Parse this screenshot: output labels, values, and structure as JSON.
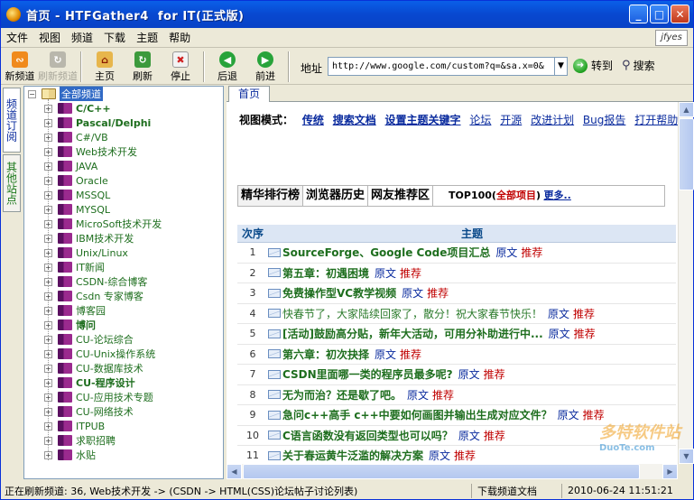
{
  "window": {
    "title": "首页 - HTFGather4  for IT(正式版)"
  },
  "menu": [
    "文件",
    "视图",
    "频道",
    "下载",
    "主题",
    "帮助"
  ],
  "logo_text": "jfyes",
  "toolbar": {
    "buttons": [
      {
        "label": "新频道",
        "icon": "rss-icon",
        "disabled": false
      },
      {
        "label": "刷新频道",
        "icon": "refresh-channel-icon",
        "disabled": true
      },
      {
        "label": "主页",
        "icon": "home-icon",
        "disabled": false
      },
      {
        "label": "刷新",
        "icon": "refresh-icon",
        "disabled": false
      },
      {
        "label": "停止",
        "icon": "stop-icon",
        "disabled": false
      },
      {
        "label": "后退",
        "icon": "back-icon",
        "disabled": false
      },
      {
        "label": "前进",
        "icon": "forward-icon",
        "disabled": false
      }
    ],
    "address_label": "地址",
    "address_value": "http://www.google.com/custom?q=&sa.x=0&",
    "goto_label": "转到",
    "search_label": "搜索"
  },
  "side_tabs": [
    "频道订阅",
    "其他站点"
  ],
  "tree": {
    "root": "全部频道",
    "items": [
      {
        "label": "C/C++",
        "bold": true
      },
      {
        "label": "Pascal/Delphi",
        "bold": true
      },
      {
        "label": "C#/VB",
        "bold": false
      },
      {
        "label": "Web技术开发",
        "bold": false
      },
      {
        "label": "JAVA",
        "bold": false
      },
      {
        "label": "Oracle",
        "bold": false
      },
      {
        "label": "MSSQL",
        "bold": false
      },
      {
        "label": "MYSQL",
        "bold": false
      },
      {
        "label": "MicroSoft技术开发",
        "bold": false
      },
      {
        "label": "IBM技术开发",
        "bold": false
      },
      {
        "label": "Unix/Linux",
        "bold": false
      },
      {
        "label": "IT新闻",
        "bold": false
      },
      {
        "label": "CSDN-综合博客",
        "bold": false
      },
      {
        "label": "Csdn 专家博客",
        "bold": false
      },
      {
        "label": "博客园",
        "bold": false
      },
      {
        "label": "博问",
        "bold": true
      },
      {
        "label": "CU-论坛综合",
        "bold": false
      },
      {
        "label": "CU-Unix操作系统",
        "bold": false
      },
      {
        "label": "CU-数据库技术",
        "bold": false
      },
      {
        "label": "CU-程序设计",
        "bold": true
      },
      {
        "label": "CU-应用技术专题",
        "bold": false
      },
      {
        "label": "CU-网络技术",
        "bold": false
      },
      {
        "label": "ITPUB",
        "bold": false
      },
      {
        "label": "求职招聘",
        "bold": false
      },
      {
        "label": "水贴",
        "bold": false
      }
    ]
  },
  "content": {
    "tab": "首页",
    "view_mode": {
      "label": "视图模式：",
      "links": [
        {
          "text": "传统",
          "bold": true
        },
        {
          "text": "搜索文档",
          "bold": true
        },
        {
          "text": "设置主题关键字",
          "bold": true
        },
        {
          "text": "论坛",
          "bold": false
        },
        {
          "text": "开源",
          "bold": false
        },
        {
          "text": "改进计划",
          "bold": false
        },
        {
          "text": "Bug报告",
          "bold": false
        },
        {
          "text": "打开帮助",
          "bold": false
        }
      ]
    },
    "rank_tabs": [
      "精华排行榜",
      "浏览器历史",
      "网友推荐区"
    ],
    "top100": {
      "prefix": "TOP100(",
      "highlight": "全部项目",
      "suffix": ")",
      "more": "更多.."
    },
    "table": {
      "headers": [
        "次序",
        "主题"
      ],
      "orig_label": "原文",
      "rec_label": "推荐",
      "rows": [
        {
          "n": "1",
          "title": "SourceForge、Google Code项目汇总",
          "bold": true
        },
        {
          "n": "2",
          "title": "第五章：初遇困境",
          "bold": true
        },
        {
          "n": "3",
          "title": "免费操作型VC教学视频",
          "bold": true
        },
        {
          "n": "4",
          "title": "快春节了，大家陆续回家了，散分！祝大家春节快乐！",
          "bold": false
        },
        {
          "n": "5",
          "title": "[活动]鼓励高分贴，新年大活动，可用分补助进行中...",
          "bold": true
        },
        {
          "n": "6",
          "title": "第六章：初次抉择",
          "bold": true
        },
        {
          "n": "7",
          "title": "CSDN里面哪一类的程序员最多呢?",
          "bold": true
        },
        {
          "n": "8",
          "title": "无为而治？还是歇了吧。",
          "bold": true
        },
        {
          "n": "9",
          "title": "急问c++高手  c++中要如何画图并输出生成对应文件？",
          "bold": true
        },
        {
          "n": "10",
          "title": "C语言函数没有返回类型也可以吗？",
          "bold": true
        },
        {
          "n": "11",
          "title": "关于春运黄牛泛滥的解决方案",
          "bold": true
        }
      ]
    }
  },
  "status": {
    "main": "正在刷新频道: 36, Web技术开发 -> (CSDN -> HTML(CSS)论坛帖子讨论列表)",
    "mid": "下载频道文档",
    "time": "2010-06-24  11:51:21"
  },
  "watermark": {
    "line1": "多特软件站",
    "line2": "DuoTe.com"
  }
}
